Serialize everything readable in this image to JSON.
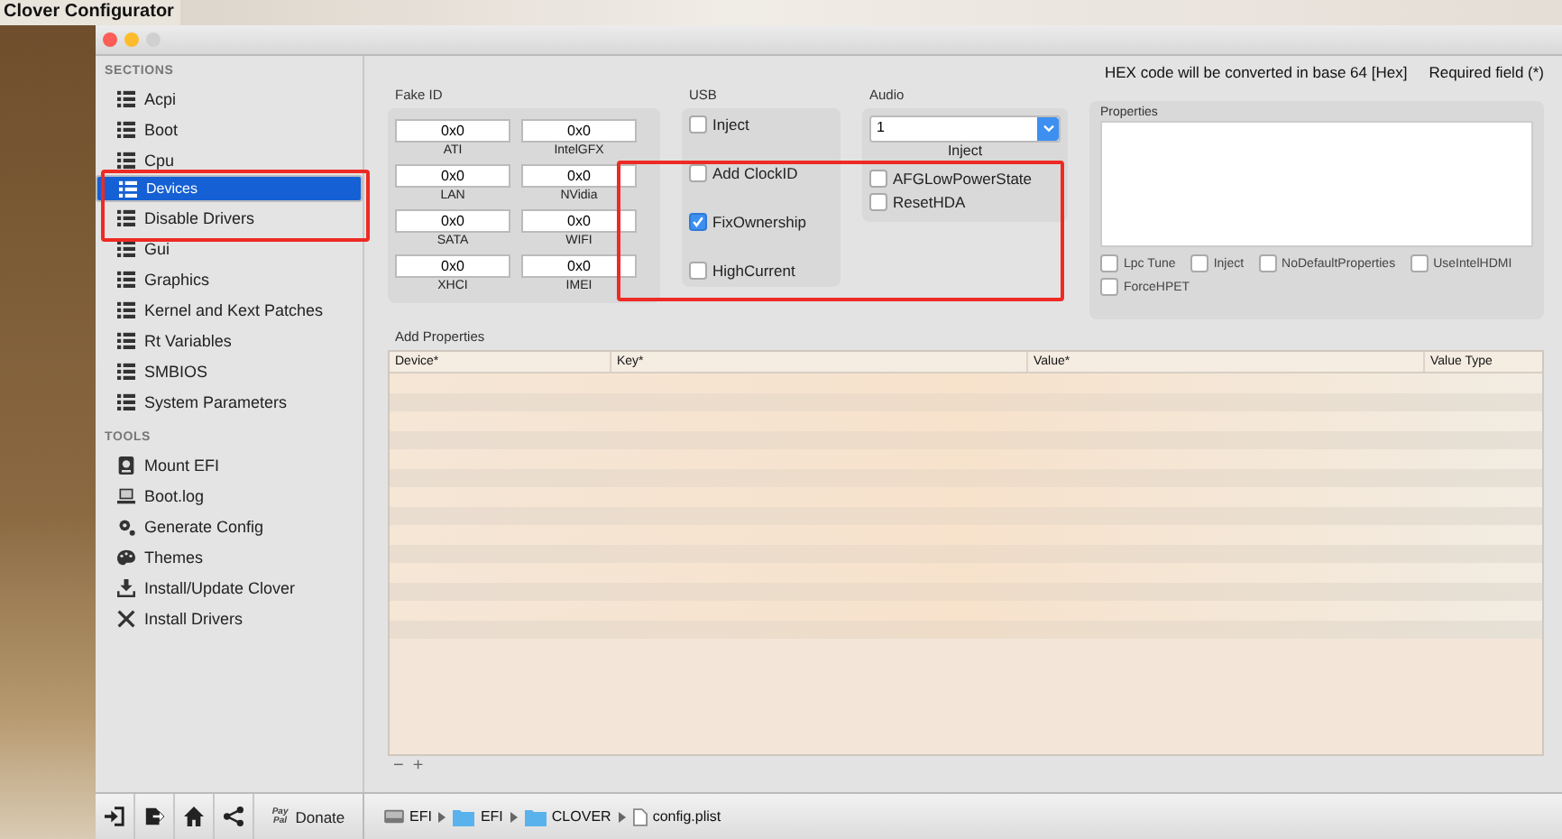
{
  "menu_bar": {
    "app_name": "Clover Configurator"
  },
  "sidebar": {
    "sections_label": "SECTIONS",
    "sections": [
      {
        "label": "Acpi",
        "selected": false
      },
      {
        "label": "Boot",
        "selected": false
      },
      {
        "label": "Cpu",
        "selected": false
      },
      {
        "label": "Devices",
        "selected": true
      },
      {
        "label": "Disable Drivers",
        "selected": false
      },
      {
        "label": "Gui",
        "selected": false
      },
      {
        "label": "Graphics",
        "selected": false
      },
      {
        "label": "Kernel and Kext Patches",
        "selected": false
      },
      {
        "label": "Rt Variables",
        "selected": false
      },
      {
        "label": "SMBIOS",
        "selected": false
      },
      {
        "label": "System Parameters",
        "selected": false
      }
    ],
    "tools_label": "TOOLS",
    "tools": [
      {
        "label": "Mount EFI",
        "kind": "disk"
      },
      {
        "label": "Boot.log",
        "kind": "laptop"
      },
      {
        "label": "Generate Config",
        "kind": "gears"
      },
      {
        "label": "Themes",
        "kind": "palette"
      },
      {
        "label": "Install/Update Clover",
        "kind": "download"
      },
      {
        "label": "Install Drivers",
        "kind": "tools"
      }
    ],
    "footer_buttons": [
      {
        "kind": "import"
      },
      {
        "kind": "export"
      },
      {
        "kind": "home"
      },
      {
        "kind": "share"
      }
    ],
    "donate": {
      "badge_lines": [
        "Pay",
        "Pal"
      ],
      "label": "Donate"
    }
  },
  "header": {
    "hex_note": "HEX code will be converted in base 64 [Hex]",
    "required_note": "Required field (*)"
  },
  "fake_id": {
    "title": "Fake ID",
    "fields": [
      {
        "value": "0x0",
        "label": "ATI"
      },
      {
        "value": "0x0",
        "label": "IntelGFX"
      },
      {
        "value": "0x0",
        "label": "LAN"
      },
      {
        "value": "0x0",
        "label": "NVidia"
      },
      {
        "value": "0x0",
        "label": "SATA"
      },
      {
        "value": "0x0",
        "label": "WIFI"
      },
      {
        "value": "0x0",
        "label": "XHCI"
      },
      {
        "value": "0x0",
        "label": "IMEI"
      }
    ]
  },
  "usb": {
    "title": "USB",
    "options": [
      {
        "label": "Inject",
        "checked": false
      },
      {
        "label": "Add ClockID",
        "checked": false
      },
      {
        "label": "FixOwnership",
        "checked": true
      },
      {
        "label": "HighCurrent",
        "checked": false
      }
    ]
  },
  "audio": {
    "title": "Audio",
    "select_value": "1",
    "inject_label": "Inject",
    "options": [
      {
        "label": "AFGLowPowerState",
        "checked": false
      },
      {
        "label": "ResetHDA",
        "checked": false
      }
    ]
  },
  "properties": {
    "title": "Properties",
    "options": [
      {
        "label": "Lpc Tune",
        "checked": false
      },
      {
        "label": "Inject",
        "checked": false
      },
      {
        "label": "NoDefaultProperties",
        "checked": false
      },
      {
        "label": "UseIntelHDMI",
        "checked": false
      },
      {
        "label": "ForceHPET",
        "checked": false
      }
    ]
  },
  "add_properties": {
    "title": "Add Properties",
    "columns": [
      "Device*",
      "Key*",
      "Value*",
      "Value Type"
    ],
    "remove": "−",
    "add": "+"
  },
  "path_bar": [
    {
      "label": "EFI",
      "kind": "drive"
    },
    {
      "label": "EFI",
      "kind": "folder"
    },
    {
      "label": "CLOVER",
      "kind": "folder"
    },
    {
      "label": "config.plist",
      "kind": "file"
    }
  ]
}
